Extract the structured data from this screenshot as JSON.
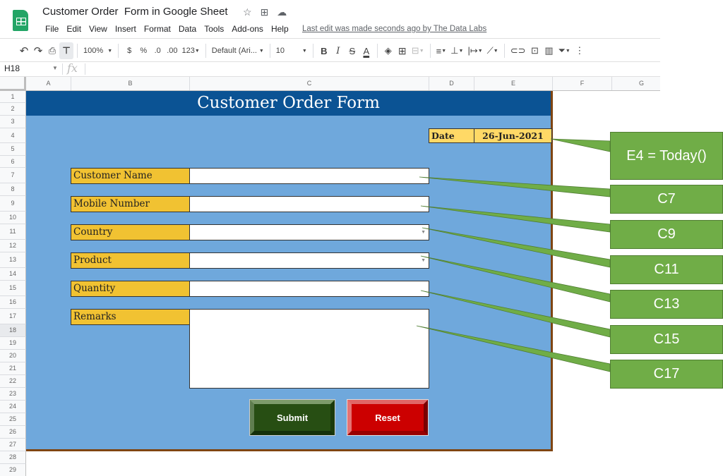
{
  "app": {
    "doc_title": "Customer Order  Form in Google Sheet",
    "title_icons": [
      "star-icon",
      "move-folder-icon",
      "cloud-saved-icon"
    ],
    "menu": [
      "File",
      "Edit",
      "View",
      "Insert",
      "Format",
      "Data",
      "Tools",
      "Add-ons",
      "Help"
    ],
    "last_edit": "Last edit was made seconds ago by The Data Labs"
  },
  "toolbar": {
    "zoom": "100%",
    "currency": "$",
    "percent": "%",
    "decrease_decimal": ".0",
    "increase_decimal": ".00",
    "more_formats": "123",
    "font": "Default (Ari...",
    "font_size": "10",
    "bold": "B",
    "italic": "I",
    "strikethrough": "S",
    "text_color": "A"
  },
  "formula_bar": {
    "name_box": "H18",
    "fx": "fx",
    "value": ""
  },
  "grid": {
    "columns": [
      "A",
      "B",
      "C",
      "D",
      "E",
      "F",
      "G"
    ],
    "rows": [
      "1",
      "2",
      "3",
      "4",
      "5",
      "6",
      "7",
      "8",
      "9",
      "10",
      "11",
      "12",
      "13",
      "14",
      "15",
      "16",
      "17",
      "18",
      "19",
      "20",
      "21",
      "22",
      "23",
      "24",
      "25",
      "26",
      "27",
      "28",
      "29"
    ],
    "active_row": "18"
  },
  "form": {
    "title": "Customer Order Form",
    "date_label": "Date",
    "date_value": "26-Jun-2021",
    "fields": [
      {
        "label": "Customer Name",
        "value": "",
        "type": "text"
      },
      {
        "label": "Mobile Number",
        "value": "",
        "type": "text"
      },
      {
        "label": "Country",
        "value": "",
        "type": "dropdown"
      },
      {
        "label": "Product",
        "value": "",
        "type": "dropdown"
      },
      {
        "label": "Quantity",
        "value": "",
        "type": "text"
      },
      {
        "label": "Remarks",
        "value": "",
        "type": "multiline"
      }
    ],
    "submit_label": "Submit",
    "reset_label": "Reset",
    "colors": {
      "header": "#0b5394",
      "background": "#6fa8dc",
      "label": "#f1c232",
      "date": "#ffd966",
      "submit": "#274e13",
      "reset": "#cc0000",
      "border": "#7f4512"
    }
  },
  "callouts": [
    {
      "text": "E4 = Today()"
    },
    {
      "text": "C7"
    },
    {
      "text": "C9"
    },
    {
      "text": "C11"
    },
    {
      "text": "C13"
    },
    {
      "text": "C15"
    },
    {
      "text": "C17"
    }
  ],
  "callout_color": "#70ad47"
}
